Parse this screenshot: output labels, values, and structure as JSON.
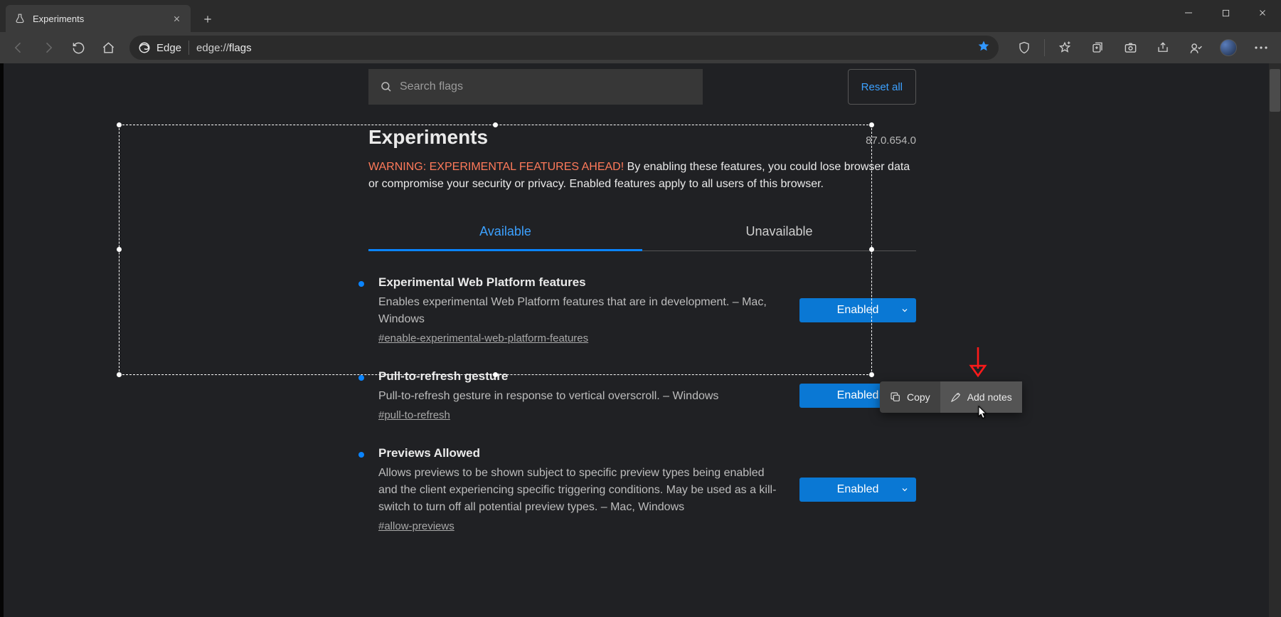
{
  "tab": {
    "title": "Experiments"
  },
  "address": {
    "chip": "Edge",
    "url_prefix": "edge://",
    "url_bold": "flags"
  },
  "search": {
    "placeholder": "Search flags"
  },
  "reset_label": "Reset all",
  "page_title": "Experiments",
  "version": "87.0.654.0",
  "warning_prefix": "WARNING: EXPERIMENTAL FEATURES AHEAD!",
  "warning_body": " By enabling these features, you could lose browser data or compromise your security or privacy. Enabled features apply to all users of this browser.",
  "tabs": {
    "available": "Available",
    "unavailable": "Unavailable"
  },
  "flags": [
    {
      "title": "Experimental Web Platform features",
      "desc": "Enables experimental Web Platform features that are in development. – Mac, Windows",
      "anchor": "#enable-experimental-web-platform-features",
      "state": "Enabled"
    },
    {
      "title": "Pull-to-refresh gesture",
      "desc": "Pull-to-refresh gesture in response to vertical overscroll. – Windows",
      "anchor": "#pull-to-refresh",
      "state": "Enabled"
    },
    {
      "title": "Previews Allowed",
      "desc": "Allows previews to be shown subject to specific preview types being enabled and the client experiencing specific triggering conditions. May be used as a kill-switch to turn off all potential preview types. – Mac, Windows",
      "anchor": "#allow-previews",
      "state": "Enabled"
    }
  ],
  "ctx": {
    "copy": "Copy",
    "addnotes": "Add notes"
  }
}
